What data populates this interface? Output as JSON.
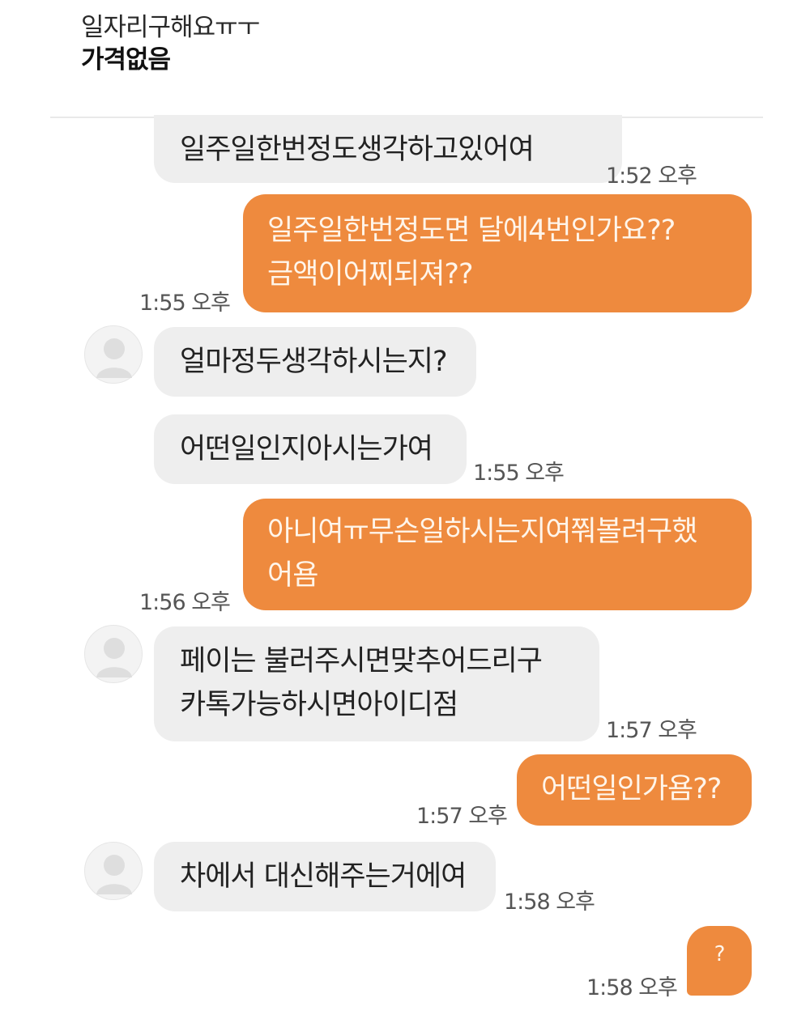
{
  "header": {
    "title": "일자리구해요ㅠㅜ",
    "price": "가격없음"
  },
  "messages": [
    {
      "side": "in",
      "lines": [
        "일주일한번정도생각하고있어여"
      ],
      "time": "1:52 오후",
      "avatar": false
    },
    {
      "side": "out",
      "lines": [
        "일주일한번정도면 달에4번인가요??",
        "금액이어찌되져??"
      ],
      "time": "1:55 오후"
    },
    {
      "side": "in",
      "lines": [
        "얼마정두생각하시는지?"
      ],
      "avatar": true
    },
    {
      "side": "in",
      "lines": [
        "어떤일인지아시는가여"
      ],
      "time": "1:55 오후",
      "avatar": false
    },
    {
      "side": "out",
      "lines": [
        "아니여ㅠ무슨일하시는지여쭤볼려구했",
        "어욤"
      ],
      "time": "1:56 오후"
    },
    {
      "side": "in",
      "lines": [
        "페이는 불러주시면맞추어드리구",
        "카톡가능하시면아이디점"
      ],
      "time": "1:57 오후",
      "avatar": true
    },
    {
      "side": "out",
      "lines": [
        "어떤일인가욤??"
      ],
      "time": "1:57 오후"
    },
    {
      "side": "in",
      "lines": [
        "차에서 대신해주는거에여"
      ],
      "time": "1:58 오후",
      "avatar": true
    },
    {
      "side": "out",
      "lines": [
        "?"
      ],
      "time": "1:58 오후"
    }
  ],
  "colors": {
    "outgoing_bubble": "#ee8a3e",
    "incoming_bubble": "#eeeeee"
  }
}
